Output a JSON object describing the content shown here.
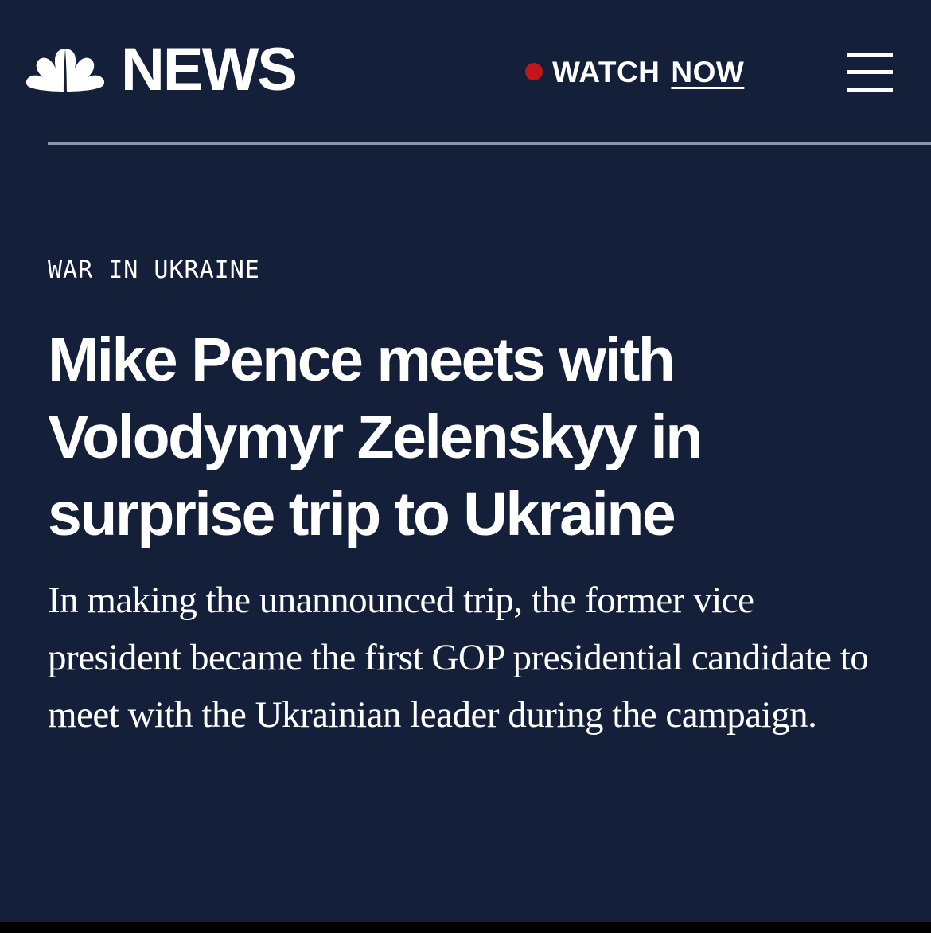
{
  "header": {
    "logo_text": "NEWS",
    "watch_label": "WATCH",
    "now_label": "NOW"
  },
  "article": {
    "eyebrow": "WAR IN UKRAINE",
    "headline": "Mike Pence meets with Volodymyr Zelenskyy in surprise trip to Ukraine",
    "dek": "In making the unannounced trip, the former vice president became the first GOP presidential candidate to meet with the Ukrainian leader during the campaign."
  },
  "icons": {
    "logo": "nbc-peacock-icon",
    "live": "live-dot-icon",
    "menu": "hamburger-menu-icon"
  },
  "colors": {
    "background": "#14203a",
    "text": "#ffffff",
    "live_dot": "#c0161c",
    "divider": "#8e96a6",
    "peacock_feathers": [
      "#ffffff"
    ]
  }
}
